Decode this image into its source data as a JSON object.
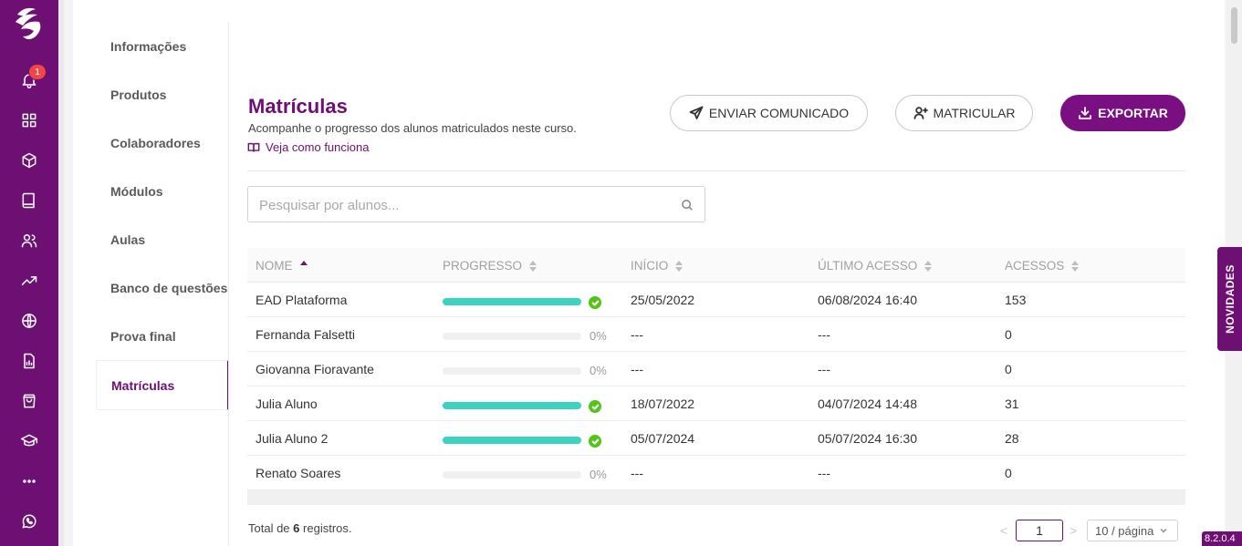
{
  "notifications": {
    "count": "1"
  },
  "submenu": {
    "items": [
      {
        "label": "Informações"
      },
      {
        "label": "Produtos"
      },
      {
        "label": "Colaboradores"
      },
      {
        "label": "Módulos"
      },
      {
        "label": "Aulas"
      },
      {
        "label": "Banco de questões"
      },
      {
        "label": "Prova final"
      },
      {
        "label": "Matrículas",
        "active": true
      }
    ]
  },
  "header": {
    "title": "Matrículas",
    "subtitle": "Acompanhe o progresso dos alunos matriculados neste curso.",
    "howto_link": "Veja como funciona",
    "buttons": {
      "send": "ENVIAR COMUNICADO",
      "enroll": "MATRICULAR",
      "export": "EXPORTAR"
    }
  },
  "search": {
    "placeholder": "Pesquisar por alunos...",
    "value": ""
  },
  "table": {
    "columns": [
      "NOME",
      "PROGRESSO",
      "INÍCIO",
      "ÚLTIMO ACESSO",
      "ACESSOS"
    ],
    "rows": [
      {
        "name": "EAD Plataforma",
        "progress": 1.0,
        "progress_label": "",
        "start": "25/05/2022",
        "last": "06/08/2024 16:40",
        "accesses": "153"
      },
      {
        "name": "Fernanda Falsetti",
        "progress": 0,
        "progress_label": "0%",
        "start": "---",
        "last": "---",
        "accesses": "0"
      },
      {
        "name": "Giovanna Fioravante",
        "progress": 0,
        "progress_label": "0%",
        "start": "---",
        "last": "---",
        "accesses": "0"
      },
      {
        "name": "Julia Aluno",
        "progress": 1.0,
        "progress_label": "",
        "start": "18/07/2022",
        "last": "04/07/2024 14:48",
        "accesses": "31"
      },
      {
        "name": "Julia Aluno 2",
        "progress": 1.0,
        "progress_label": "",
        "start": "05/07/2024",
        "last": "05/07/2024 16:30",
        "accesses": "28"
      },
      {
        "name": "Renato Soares",
        "progress": 0,
        "progress_label": "0%",
        "start": "---",
        "last": "---",
        "accesses": "0"
      }
    ]
  },
  "footer": {
    "total_prefix": "Total de",
    "total_count": "6",
    "total_suffix": "registros.",
    "prev": "<",
    "current_page": "1",
    "next": ">",
    "page_size": "10 / página"
  },
  "novidades": "NOVIDADES",
  "version": "8.2.0.4",
  "colors": {
    "brand": "#6d0f73",
    "progress": "#3cd3c0",
    "complete": "#52c41a"
  }
}
